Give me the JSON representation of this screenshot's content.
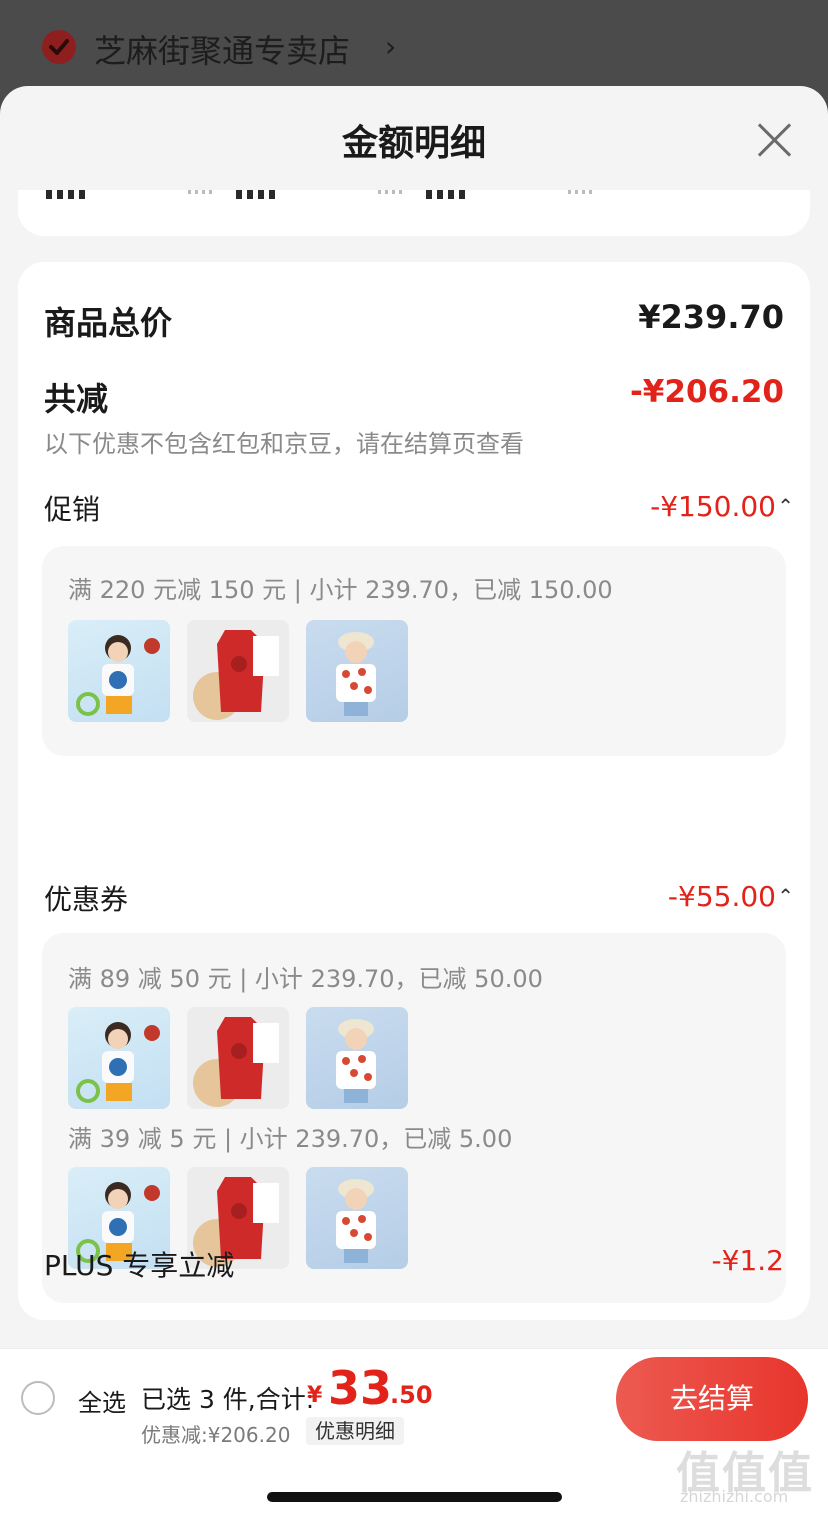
{
  "store": {
    "name": "芝麻街聚通专卖店",
    "chevron": "›"
  },
  "sheet": {
    "title": "金额明细",
    "close_icon": "close-icon",
    "total": {
      "label": "商品总价",
      "value": "¥239.70"
    },
    "reduce": {
      "label": "共减",
      "value": "-¥206.20",
      "note": "以下优惠不包含红包和京豆，请在结算页查看"
    },
    "promotion": {
      "label": "促销",
      "value": "-¥150.00",
      "caret": "⌃",
      "rules": [
        {
          "text": "满 220 元减 150 元 | 小计 239.70，已减 150.00"
        }
      ]
    },
    "coupon": {
      "label": "优惠券",
      "value": "-¥55.00",
      "caret": "⌃",
      "rules": [
        {
          "text": "满 89 减 50 元 | 小计 239.70，已减 50.00"
        },
        {
          "text": "满 39 减 5 元 | 小计 239.70，已减 5.00"
        }
      ]
    },
    "plus": {
      "label": "PLUS 专享立减",
      "value": "-¥1.2"
    }
  },
  "bottom_bar": {
    "select_all": "全选",
    "selected": "已选 3 件,合计:",
    "price_currency": "¥",
    "price_int": "33",
    "price_dec": ".50",
    "discount": "优惠减:¥206.20",
    "detail_button": "优惠明细",
    "checkout_button": "去结算"
  },
  "watermark": {
    "glyphs": "值值值",
    "url": "zhizhizhi.com"
  },
  "colors": {
    "accent": "#e2231a",
    "checkout_gradient_start": "#ec5a51",
    "checkout_gradient_end": "#e8352c",
    "sheet_bg": "#f4f4f4"
  }
}
